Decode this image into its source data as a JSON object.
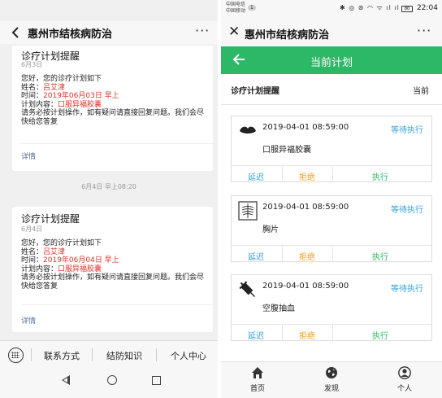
{
  "left": {
    "title": "惠州市结核病防治",
    "more": "···",
    "messages": [
      {
        "title": "诊疗计划提醒",
        "date": "6月3日",
        "greeting": "您好，您的诊疗计划如下",
        "name_label": "姓名：",
        "name": "吕艾津",
        "time_label": "时间：",
        "time": "2019年06月03日 早上",
        "plan_label": "计划内容：",
        "plan": "口服异福胶囊",
        "note": "请务必按计划操作，如有疑问请直接回复问题。我们会尽快给您答复",
        "detail": "详情"
      },
      {
        "title": "诊疗计划提醒",
        "date": "6月4日",
        "greeting": "您好，您的诊疗计划如下",
        "name_label": "姓名：",
        "name": "吕艾津",
        "time_label": "时间：",
        "time": "2019年06月04日 早上",
        "plan_label": "计划内容：",
        "plan": "口服异福胶囊",
        "note": "请务必按计划操作，如有疑问请直接回复问题。我们会尽快给您答复",
        "detail": "详情"
      }
    ],
    "timestamp": "6月4日 早上08:20",
    "menu": [
      "联系方式",
      "结防知识",
      "个人中心"
    ]
  },
  "right": {
    "status": {
      "carrier1": "中国电信",
      "carrier2": "中国移动",
      "badge": "1",
      "icons": "✱ ◎ ⊛ ◠ ᯤ ıl ıl",
      "battery": "80",
      "time": "22:04"
    },
    "title": "惠州市结核病防治",
    "more": "···",
    "page_title": "当前计划",
    "section_title": "诊疗计划提醒",
    "section_right": "当前",
    "cards": [
      {
        "time": "2019-04-01 08:59:00",
        "status": "等待执行",
        "name": "口服异福胶囊",
        "icon": "pill-icon"
      },
      {
        "time": "2019-04-01 08:59:00",
        "status": "等待执行",
        "name": "胸片",
        "icon": "xray-icon"
      },
      {
        "time": "2019-04-01 08:59:00",
        "status": "等待执行",
        "name": "空腹抽血",
        "icon": "syringe-icon"
      }
    ],
    "actions": {
      "delay": "延迟",
      "reject": "拒绝",
      "execute": "执行"
    },
    "tabs": [
      {
        "label": "首页",
        "icon": "home-icon"
      },
      {
        "label": "发现",
        "icon": "globe-icon"
      },
      {
        "label": "个人",
        "icon": "person-icon"
      }
    ]
  },
  "colors": {
    "accent_green": "#2cb866",
    "status_blue": "#36a3d6",
    "reject_orange": "#f0a020",
    "highlight_red": "#e0322b",
    "link_blue": "#576b95"
  }
}
